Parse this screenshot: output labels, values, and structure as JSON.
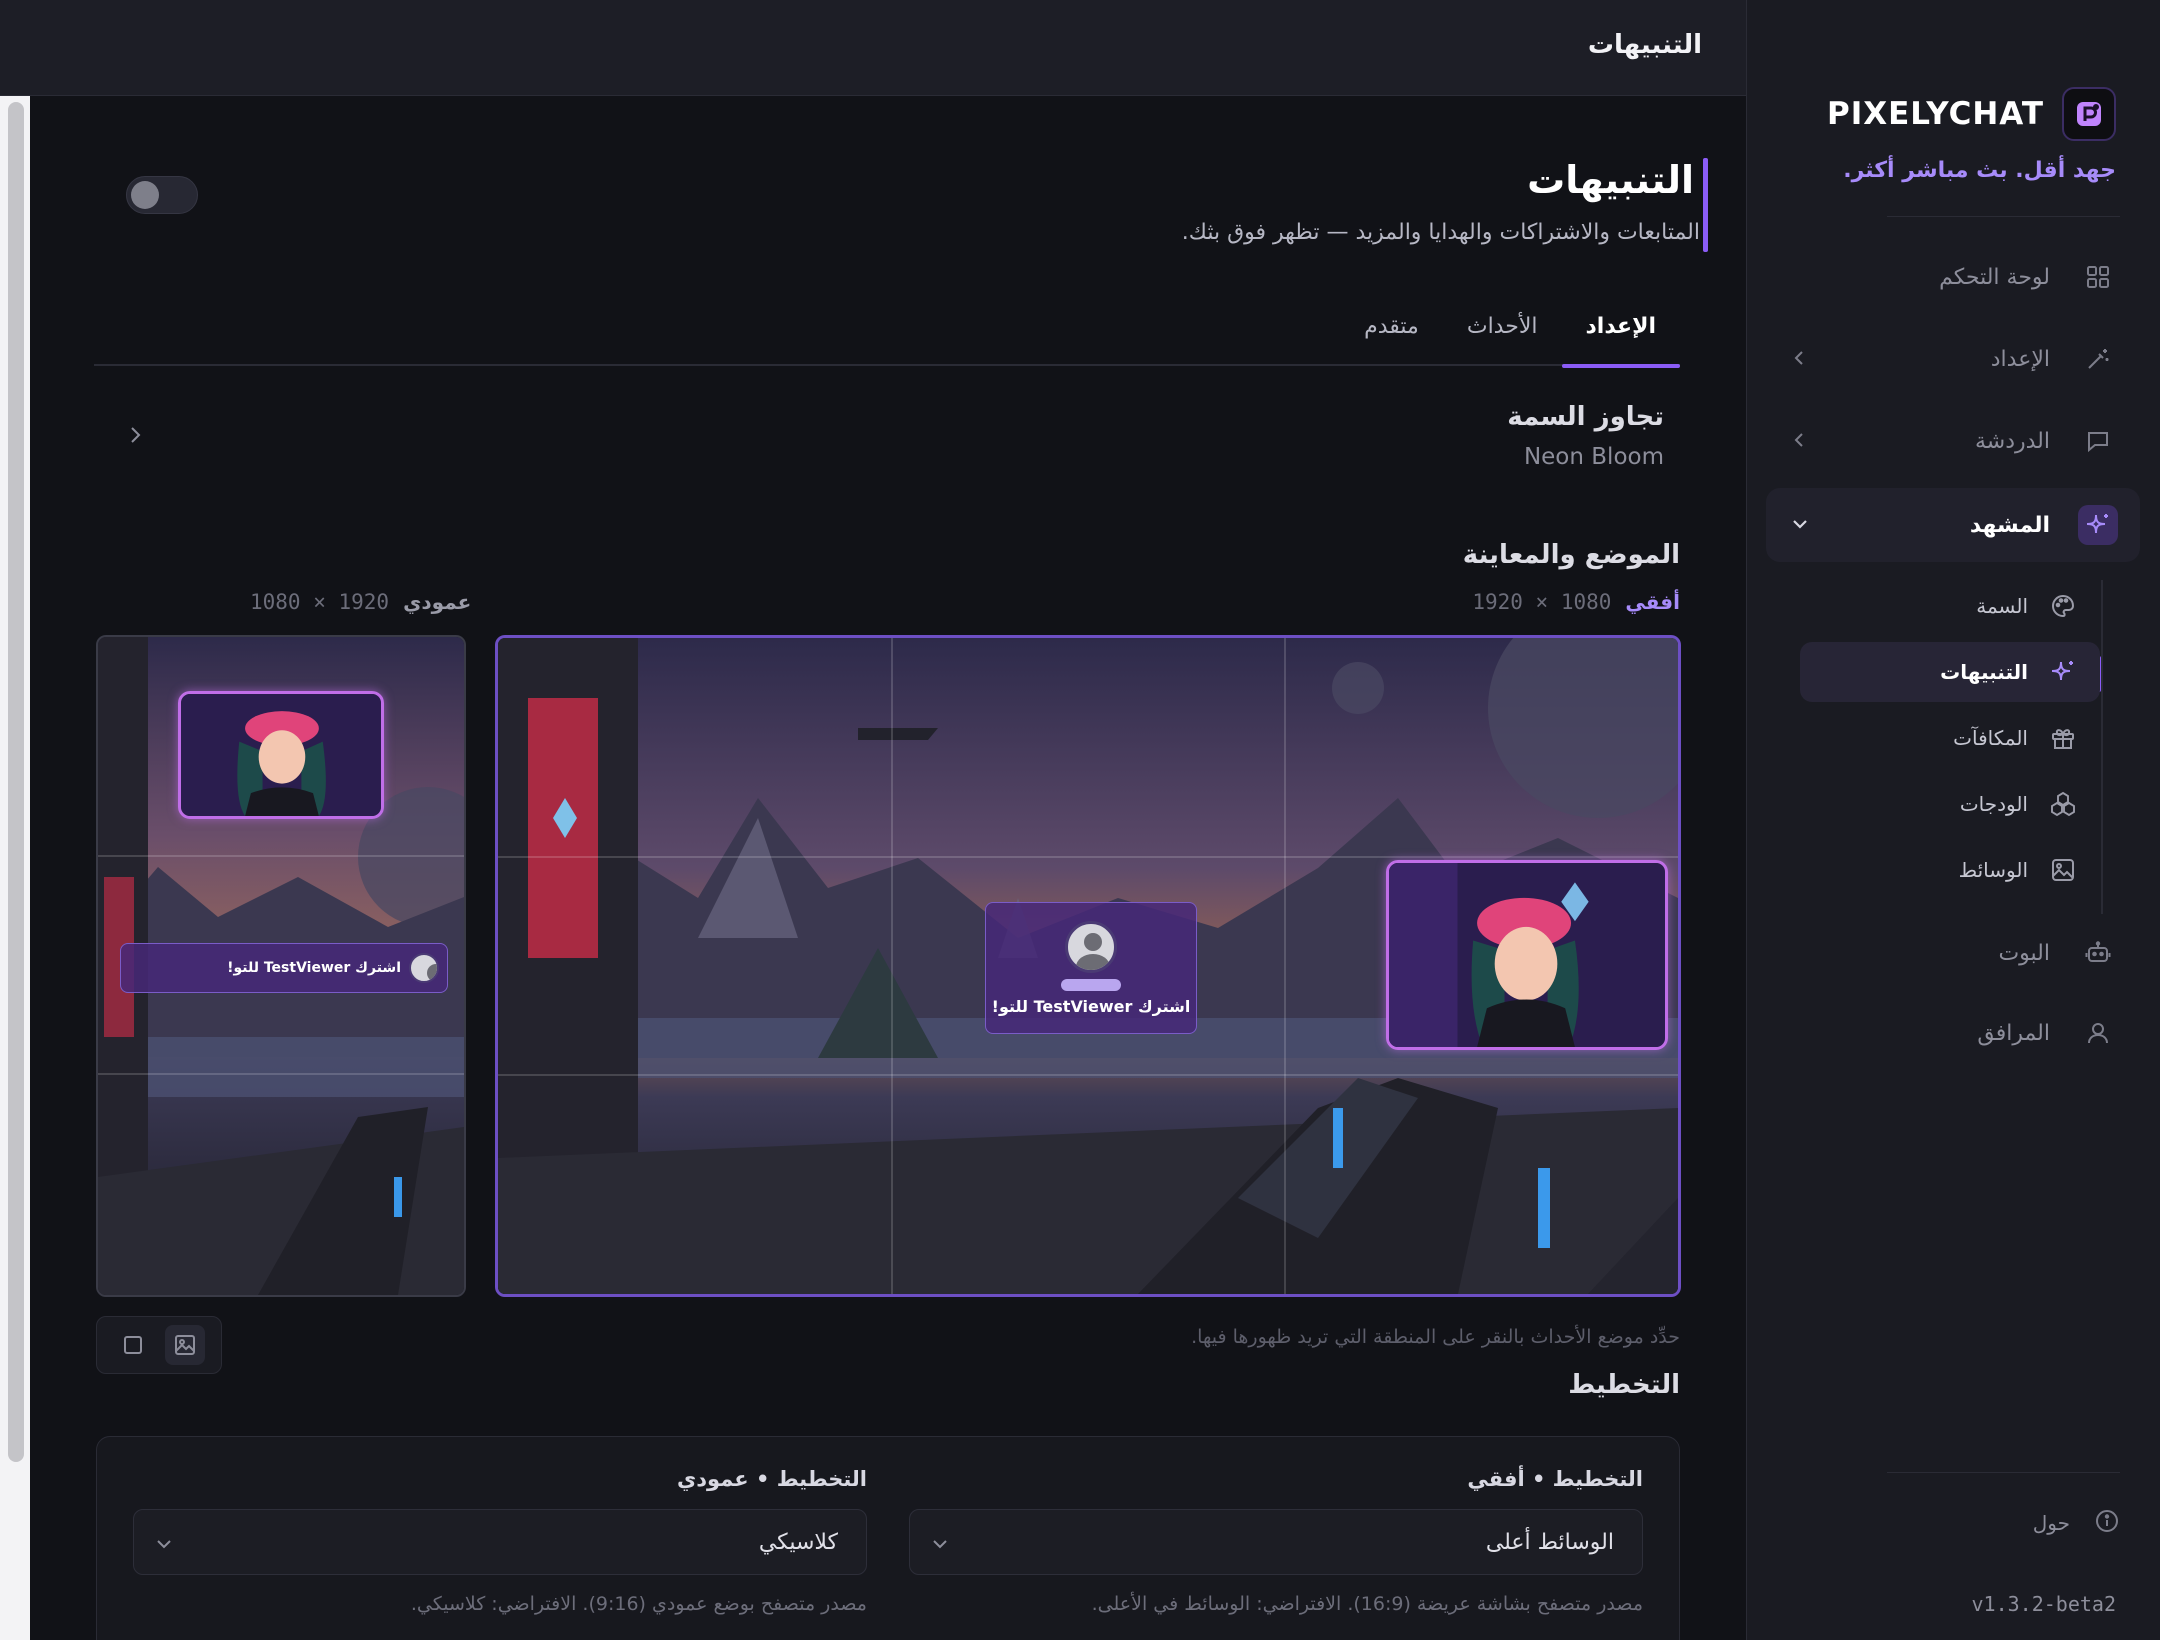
{
  "topbar": {
    "title": "التنبيهات"
  },
  "brand": {
    "name": "PIXELYCHAT",
    "tagline": "جهد أقل. بث مباشر أكثر."
  },
  "nav": {
    "dashboard": "لوحة التحكم",
    "setup": "الإعداد",
    "chat": "الدردشة",
    "scene": "المشهد",
    "bot": "البوت",
    "companion": "المرافق",
    "about": "حول"
  },
  "subnav": {
    "theme": "السمة",
    "alerts": "التنبيهات",
    "rewards": "المكافآت",
    "widgets": "الودجات",
    "media": "الوسائط"
  },
  "version": "v1.3.2-beta2",
  "page": {
    "title": "التنبيهات",
    "subtitle": "المتابعات والاشتراكات والهدايا والمزيد — تظهر فوق بثك.",
    "enabled": false
  },
  "tabs": [
    "الإعداد",
    "الأحداث",
    "متقدم"
  ],
  "theme_override": {
    "title": "تجاوز السمة",
    "value": "Neon Bloom"
  },
  "position": {
    "title": "الموضع والمعاينة",
    "horizontal": {
      "label": "أفقي",
      "dims": "1920 × 1080"
    },
    "vertical": {
      "label": "عمودي",
      "dims": "1080 × 1920"
    },
    "alert_text": "اشترك TestViewer للتو!",
    "hint": "حدِّد موضع الأحداث بالنقر على المنطقة التي تريد ظهورها فيها."
  },
  "layout": {
    "title": "التخطيط",
    "horizontal": {
      "label": "التخطيط • أفقي",
      "value": "الوسائط أعلى",
      "help": "مصدر متصفح بشاشة عريضة (16:9). الافتراضي: الوسائط في الأعلى."
    },
    "vertical": {
      "label": "التخطيط • عمودي",
      "value": "كلاسيكي",
      "help": "مصدر متصفح بوضع عمودي (9:16). الافتراضي: كلاسيكي."
    }
  },
  "colors": {
    "accent": "#8b5cf6",
    "accent_light": "#a78bfa",
    "bg": "#111217",
    "sidebar": "#1a1b22"
  },
  "icons": {
    "dashboard": "grid-icon",
    "setup": "wand-icon",
    "chat": "message-icon",
    "scene": "sparkle-icon",
    "theme": "palette-icon",
    "alerts": "sparkle-icon",
    "rewards": "gift-icon",
    "widgets": "cubes-icon",
    "media": "image-icon",
    "bot": "bot-icon",
    "companion": "user-icon",
    "about": "info-icon"
  }
}
